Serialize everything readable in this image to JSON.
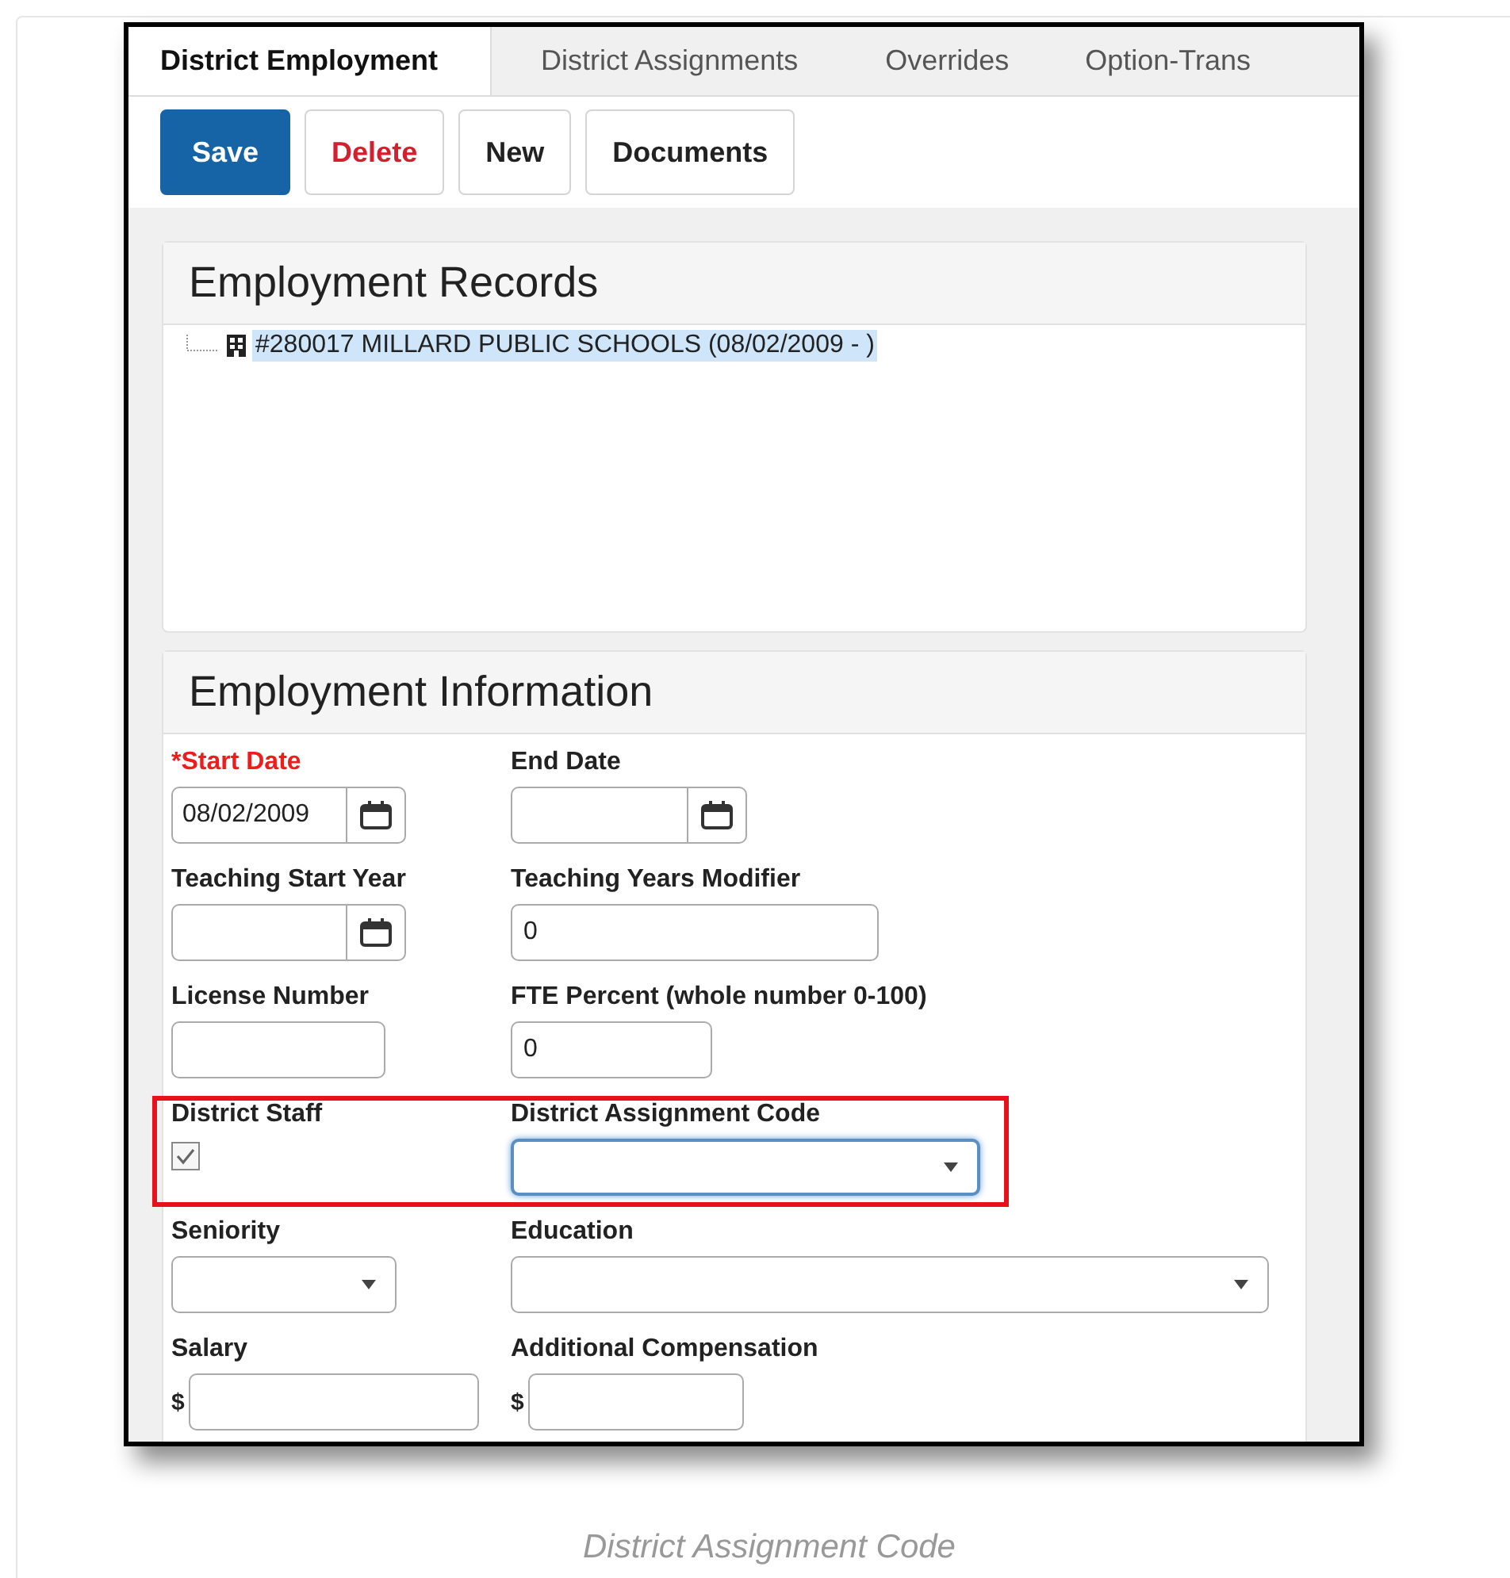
{
  "tabs": [
    {
      "label": "District Employment",
      "selected": true
    },
    {
      "label": "District Assignments",
      "selected": false
    },
    {
      "label": "Overrides",
      "selected": false
    },
    {
      "label": "Option-Trans",
      "selected": false
    }
  ],
  "toolbar": [
    {
      "label": "Save",
      "kind": "primary"
    },
    {
      "label": "Delete",
      "kind": "danger"
    },
    {
      "label": "New",
      "kind": "default"
    },
    {
      "label": "Documents",
      "kind": "default"
    }
  ],
  "employment_records": {
    "title": "Employment Records",
    "items": [
      {
        "label": "#280017 MILLARD PUBLIC SCHOOLS (08/02/2009 - )",
        "selected": true
      }
    ]
  },
  "employment_information": {
    "title": "Employment Information",
    "rows": [
      {
        "highlighted": false,
        "fields": [
          {
            "label": "*Start Date",
            "required": true,
            "kind": "date",
            "value": "08/02/2009"
          },
          {
            "label": "End Date",
            "required": false,
            "kind": "date"
          }
        ]
      },
      {
        "highlighted": false,
        "fields": [
          {
            "label": "Teaching Start Year",
            "required": false,
            "kind": "date"
          },
          {
            "label": "Teaching Years Modifier",
            "required": false,
            "kind": "text",
            "value": "0"
          }
        ]
      },
      {
        "highlighted": false,
        "fields": [
          {
            "label": "License Number",
            "required": false,
            "kind": "text"
          },
          {
            "label": "FTE Percent (whole number 0-100)",
            "required": false,
            "kind": "text",
            "value": "0"
          }
        ]
      },
      {
        "highlighted": true,
        "fields": [
          {
            "label": "District Staff",
            "required": false,
            "kind": "checkbox",
            "checked": true
          },
          {
            "label": "District Assignment Code",
            "required": false,
            "kind": "select",
            "focused": true
          }
        ]
      },
      {
        "highlighted": false,
        "fields": [
          {
            "label": "Seniority",
            "required": false,
            "kind": "select",
            "focused": false
          },
          {
            "label": "Education",
            "required": false,
            "kind": "select",
            "focused": false
          }
        ]
      },
      {
        "highlighted": false,
        "fields": [
          {
            "label": "Salary",
            "required": false,
            "kind": "money",
            "currency": "$"
          },
          {
            "label": "Additional Compensation",
            "required": false,
            "kind": "money",
            "currency": "$"
          }
        ]
      }
    ]
  },
  "caption": "District Assignment Code"
}
